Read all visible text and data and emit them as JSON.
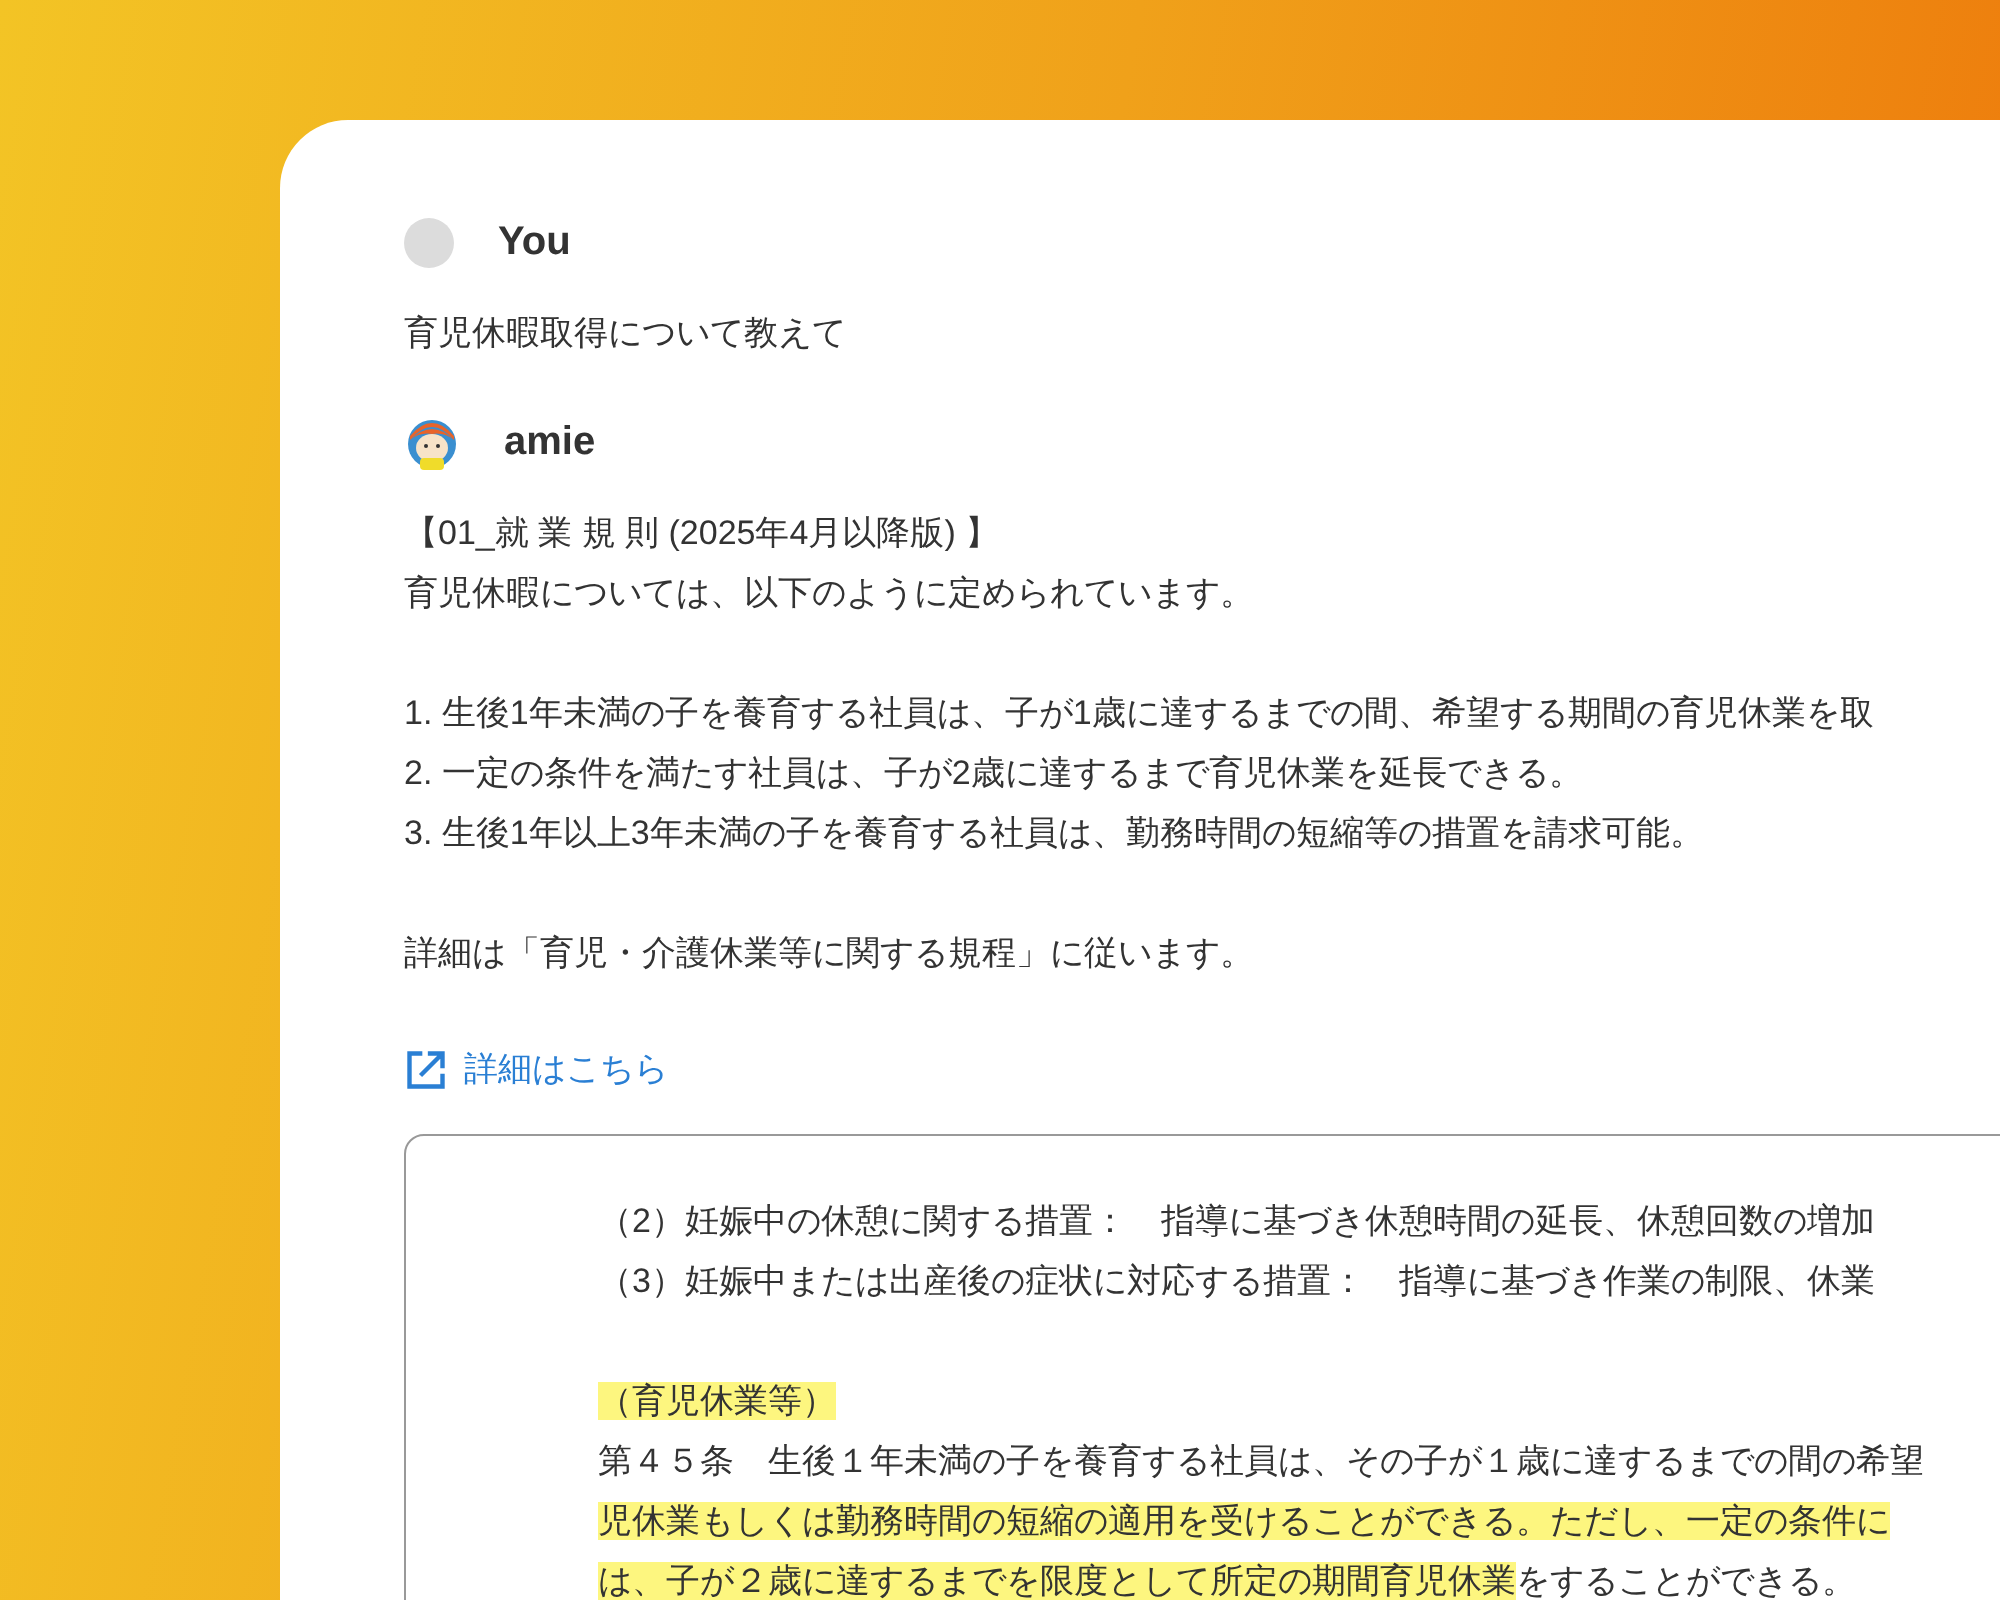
{
  "messages": [
    {
      "kind": "user",
      "author": "You",
      "text": "育児休暇取得について教えて"
    },
    {
      "kind": "assistant",
      "author": "amie",
      "paragraphs": [
        [
          "【01_就 業 規 則 (2025年4月以降版) 】",
          "育児休暇については、以下のように定められています。"
        ],
        [
          "1. 生後1年未満の子を養育する社員は、子が1歳に達するまでの間、希望する期間の育児休業を取",
          "2. 一定の条件を満たす社員は、子が2歳に達するまで育児休業を延長できる。",
          "3. 生後1年以上3年未満の子を養育する社員は、勤務時間の短縮等の措置を請求可能。"
        ],
        [
          "詳細は「育児・介護休業等に関する規程」に従います。"
        ]
      ],
      "link": "詳細はこちら",
      "document": {
        "paragraphs": [
          [
            [
              {
                "text": "（2）妊娠中の休憩に関する措置：　指導に基づき休憩時間の延長、休憩回数の増加",
                "highlighted": false
              }
            ],
            [
              {
                "text": "（3）妊娠中または出産後の症状に対応する措置：　指導に基づき作業の制限、休業",
                "highlighted": false
              }
            ]
          ],
          [
            [
              {
                "text": "（育児休業等）",
                "highlighted": true
              }
            ],
            [
              {
                "text": "第４５条　生後１年未満の子を養育する社員は、その子が１歳に達するまでの間の希望",
                "highlighted": false
              }
            ],
            [
              {
                "text": "児休業もしくは勤務時間の短縮の適用を受けることができる。ただし、一定の条件に",
                "highlighted": true
              }
            ],
            [
              {
                "text": "は、子が２歳に達するまでを限度として所定の期間育児休業",
                "highlighted": true
              },
              {
                "text": "をすることができる。",
                "highlighted": false
              }
            ]
          ]
        ]
      }
    }
  ]
}
